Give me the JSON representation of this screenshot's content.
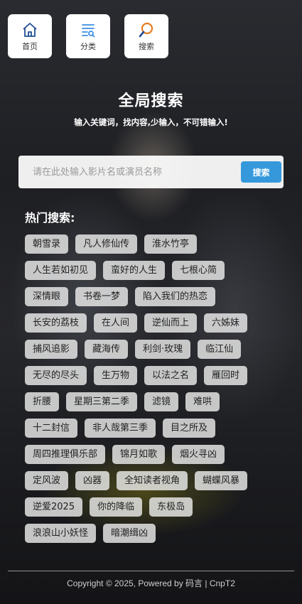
{
  "nav": [
    {
      "label": "首页",
      "icon": "home-icon"
    },
    {
      "label": "分类",
      "icon": "category-list-icon"
    },
    {
      "label": "搜索",
      "icon": "search-icon"
    }
  ],
  "header": {
    "title": "全局搜索",
    "subtitle": "输入关键词，找内容,少输入，不可错输入!"
  },
  "search": {
    "placeholder": "请在此处输入影片名或演员名称",
    "value": "",
    "button_label": "搜索"
  },
  "hot": {
    "title": "热门搜索:",
    "items": [
      "朝雪录",
      "凡人修仙传",
      "淮水竹亭",
      "人生若如初见",
      "蛮好的人生",
      "七根心简",
      "深情眼",
      "书卷一梦",
      "陷入我们的热恋",
      "长安的荔枝",
      "在人间",
      "逆仙而上",
      "六姊妹",
      "捕风追影",
      "藏海传",
      "利剑·玫瑰",
      "临江仙",
      "无尽的尽头",
      "生万物",
      "以法之名",
      "雁回时",
      "折腰",
      "星期三第二季",
      "滤镜",
      "难哄",
      "十二封信",
      "非人哉第三季",
      "目之所及",
      "周四推理俱乐部",
      "锦月如歌",
      "烟火寻凶",
      "定风波",
      "凶器",
      "全知读者视角",
      "蝴蝶风暴",
      "逆爱2025",
      "你的降临",
      "东极岛",
      "浪浪山小妖怪",
      "暗潮缉凶"
    ]
  },
  "footer": {
    "text": "Copyright © 2025, Powered by 码言 | CnpT2"
  },
  "colors": {
    "accent": "#3498db",
    "nav_icon": "#1f4e96",
    "search_icon_ring": "#e67e22"
  }
}
